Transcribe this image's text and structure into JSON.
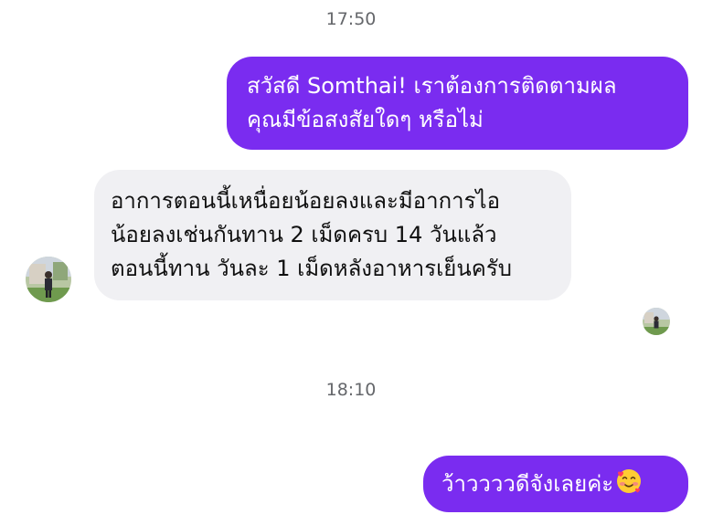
{
  "conversation": {
    "timestamps": [
      "17:50",
      "18:10"
    ],
    "messages": [
      {
        "direction": "outgoing",
        "text": "สวัสดี Somthai! เราต้องการติดตามผล\nคุณมีข้อสงสัยใดๆ หรือไม่"
      },
      {
        "direction": "incoming",
        "text": "อาการตอนนี้เหนื่อยน้อยลงและมีอาการไอ\nน้อยลงเช่นกันทาน 2 เม็ดครบ 14 วันแล้ว\nตอนนี้ทาน วันละ 1 เม็ดหลังอาหารเย็นครับ"
      },
      {
        "direction": "outgoing",
        "text": "ว้าววววดีจังเลยค่ะ",
        "emoji": "smiling-face-with-hearts-icon"
      }
    ]
  },
  "colors": {
    "outgoing_bubble": "#7a2cf0",
    "incoming_bubble": "#f0f0f3",
    "timestamp_text": "#65676b"
  }
}
